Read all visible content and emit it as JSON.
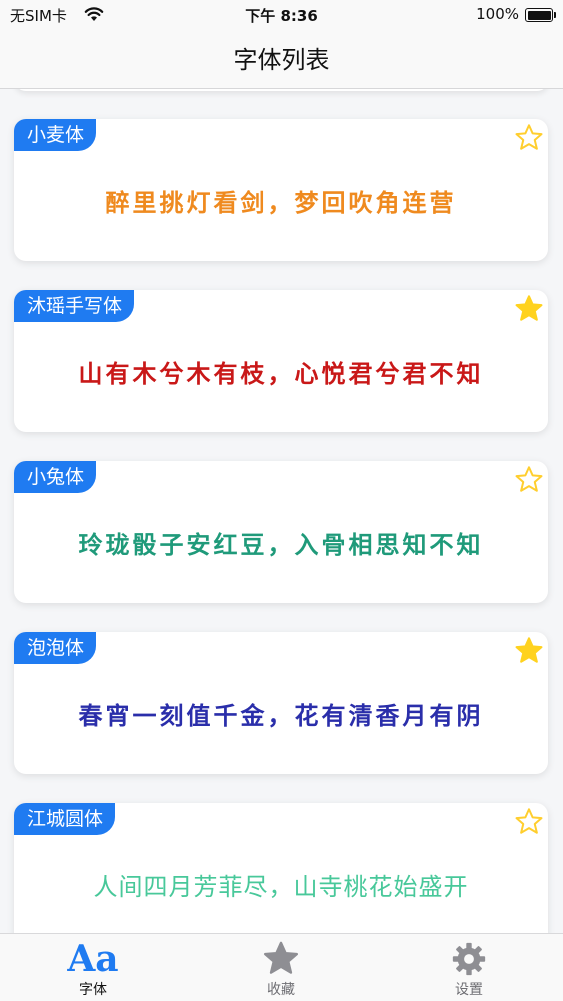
{
  "status_bar": {
    "carrier": "无SIM卡",
    "time": "下午 8:36",
    "battery": "100%"
  },
  "nav": {
    "title": "字体列表"
  },
  "colors": {
    "accent": "#1f7bf1",
    "star_outline": "#ffce2e",
    "star_filled": "#ffd21f",
    "tab_inactive": "#8e8e93"
  },
  "fonts": [
    {
      "name": "小麦体",
      "sample": "醉里挑灯看剑，梦回吹角连营",
      "color": "#ef8a1f",
      "favorited": false
    },
    {
      "name": "沐瑶手写体",
      "sample": "山有木兮木有枝，心悦君兮君不知",
      "color": "#c91818",
      "favorited": true
    },
    {
      "name": "小兔体",
      "sample": "玲珑骰子安红豆，入骨相思知不知",
      "color": "#1f9a7a",
      "favorited": false
    },
    {
      "name": "泡泡体",
      "sample": "春宵一刻值千金，花有清香月有阴",
      "color": "#2a2eaa",
      "favorited": true
    },
    {
      "name": "江城圆体",
      "sample": "人间四月芳菲尽，山寺桃花始盛开",
      "color": "#48c89a",
      "favorited": false
    }
  ],
  "tabs": [
    {
      "label": "字体",
      "icon": "aa-font-icon",
      "glyph": "Aa",
      "active": true
    },
    {
      "label": "收藏",
      "icon": "star-icon",
      "active": false
    },
    {
      "label": "设置",
      "icon": "gear-icon",
      "active": false
    }
  ]
}
